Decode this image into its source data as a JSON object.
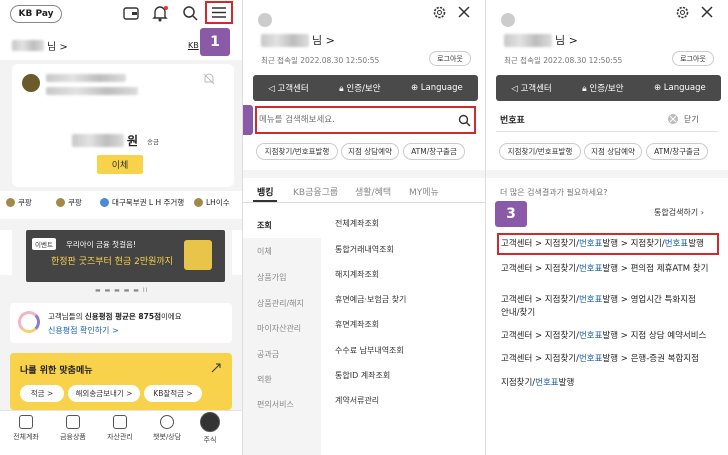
{
  "colors": {
    "accent": "#f8d24b",
    "marker": "#8a5aa8",
    "highlight_border": "#d12a2a",
    "dark_bar": "#4a4a4a",
    "link": "#1a5fb4"
  },
  "markers": [
    "1",
    "2",
    "3"
  ],
  "home": {
    "logo": "KB Pay",
    "greeting_suffix": "님 >",
    "kb_link": "KB",
    "currency_suffix": "원",
    "transfer_small": "송금",
    "transfer_button": "이체",
    "chips": [
      "쿠팡",
      "쿠팡",
      "대구북부권 L H 주거행",
      "LH이수"
    ],
    "event_badge": "이벤트",
    "promo_line1": "우리아이 금융 첫걸음!",
    "promo_line2": "한정판 굿즈부터 현금 2만원까지",
    "pager": "▬ ▬ ▬ ▬ ▬  II",
    "credit_line1_prefix": "고객님들의 ",
    "credit_line1_bold": "신용평점 평균은 875점",
    "credit_line1_suffix": "이에요",
    "credit_link": "신용평점 확인하기 >",
    "menu_title": "나를 위한 맞춤메뉴",
    "menu_chips": [
      "적금 >",
      "해외송금보내기 >",
      "KB잘적금 >"
    ],
    "tabs": [
      "전체계좌",
      "금융상품",
      "자산관리",
      "챗봇/상담",
      "주식"
    ]
  },
  "menu": {
    "greeting_suffix": "님 >",
    "last_login": "최근 접속일 2022.08.30 12:50:55",
    "logout": "로그아웃",
    "bar": [
      "고객센터",
      "인증/보안",
      "Language"
    ],
    "search_placeholder": "메뉴를 검색해보세요.",
    "quick": [
      "지점찾기/번호표발행",
      "지점 상담예약",
      "ATM/창구출금"
    ],
    "cats": [
      "뱅킹",
      "KB금융그룹",
      "생활/혜택",
      "MY메뉴"
    ],
    "side": [
      "조회",
      "이체",
      "상품가입",
      "상품관리/해지",
      "마이자산관리",
      "공과금",
      "외환",
      "편의서비스"
    ],
    "items": [
      "전체계좌조회",
      "통합거래내역조회",
      "해지계좌조회",
      "휴면예금·보험금 찾기",
      "휴면계좌조회",
      "수수료 납부내역조회",
      "통합ID 계좌조회",
      "계약서류관리"
    ]
  },
  "search": {
    "greeting_suffix": "님 >",
    "last_login": "최근 접속일 2022.08.30 12:50:55",
    "logout": "로그아웃",
    "bar": [
      "고객센터",
      "인증/보안",
      "Language"
    ],
    "query": "번호표",
    "close": "닫기",
    "quick": [
      "지점찾기/번호표발행",
      "지점 상담예약",
      "ATM/창구출금"
    ],
    "more": "더 많은 검색결과가 필요하세요?",
    "unified": "통합검색하기",
    "results": [
      [
        "고객센터 > 지점찾기/",
        "번호표",
        "발행 > 지점찾기/",
        "번호표",
        "발행"
      ],
      [
        "고객센터 > 지점찾기/",
        "번호표",
        "발행 > 편의점 제휴ATM 찾기",
        "",
        ""
      ],
      [
        "고객센터 > 지점찾기/",
        "번호표",
        "발행 > 영업시간 특화지점",
        "",
        ""
      ],
      [
        "안내/찾기",
        "",
        "",
        "",
        ""
      ],
      [
        "고객센터 > 지점찾기/",
        "번호표",
        "발행 > 지점 상담 예약서비스",
        "",
        ""
      ],
      [
        "고객센터 > 지점찾기/",
        "번호표",
        "발행 > 은행-증권 복합지점",
        "",
        ""
      ],
      [
        "지점찾기/",
        "번호표",
        "발행",
        "",
        ""
      ]
    ]
  }
}
